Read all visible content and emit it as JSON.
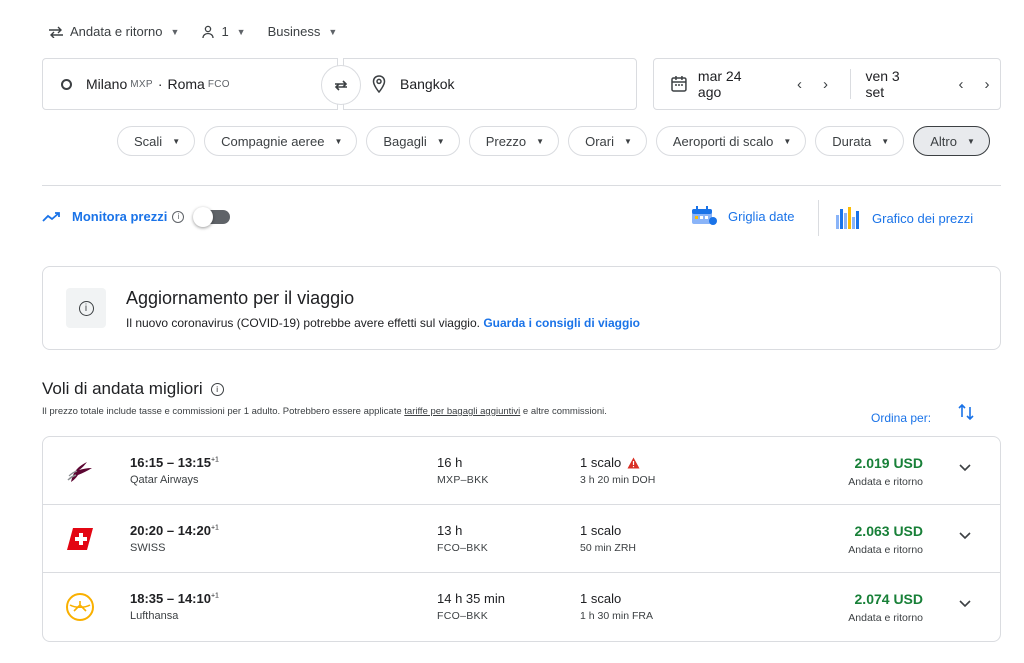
{
  "options": {
    "trip_type": "Andata e ritorno",
    "passengers": "1",
    "cabin": "Business"
  },
  "search": {
    "origin_city1": "Milano",
    "origin_code1": "MXP",
    "origin_sep": "·",
    "origin_city2": "Roma",
    "origin_code2": "FCO",
    "destination": "Bangkok",
    "depart_date": "mar 24 ago",
    "return_date": "ven 3 set"
  },
  "filters": [
    "Scali",
    "Compagnie aeree",
    "Bagagli",
    "Prezzo",
    "Orari",
    "Aeroporti di scalo",
    "Durata",
    "Altro"
  ],
  "tools": {
    "track_label": "Monitora prezzi",
    "date_grid": "Griglia date",
    "price_graph": "Grafico dei prezzi"
  },
  "notice": {
    "title": "Aggiornamento per il viaggio",
    "text": "Il nuovo coronavirus (COVID-19) potrebbe avere effetti sul viaggio.",
    "link": "Guarda i consigli di viaggio"
  },
  "results": {
    "title": "Voli di andata migliori",
    "disclaimer_pre": "Il prezzo totale include tasse e commissioni per 1 adulto. Potrebbero essere applicate",
    "disclaimer_link": "tariffe per bagagli aggiuntivi",
    "disclaimer_post": "e altre commissioni.",
    "sort_label": "Ordina per:"
  },
  "flights": [
    {
      "depart": "16:15",
      "arrive": "13:15",
      "plus": "+1",
      "airline": "Qatar Airways",
      "duration": "16 h",
      "route": "MXP–BKK",
      "stops": "1 scalo",
      "warning": true,
      "layover": "3 h 20 min DOH",
      "price": "2.019 USD",
      "price_type": "Andata e ritorno"
    },
    {
      "depart": "20:20",
      "arrive": "14:20",
      "plus": "+1",
      "airline": "SWISS",
      "duration": "13 h",
      "route": "FCO–BKK",
      "stops": "1 scalo",
      "warning": false,
      "layover": "50 min ZRH",
      "price": "2.063 USD",
      "price_type": "Andata e ritorno"
    },
    {
      "depart": "18:35",
      "arrive": "14:10",
      "plus": "+1",
      "airline": "Lufthansa",
      "duration": "14 h 35 min",
      "route": "FCO–BKK",
      "stops": "1 scalo",
      "warning": false,
      "layover": "1 h 30 min FRA",
      "price": "2.074 USD",
      "price_type": "Andata e ritorno"
    }
  ],
  "colors": {
    "accent": "#1a73e8",
    "price_green": "#188038",
    "warning_red": "#d93025"
  }
}
